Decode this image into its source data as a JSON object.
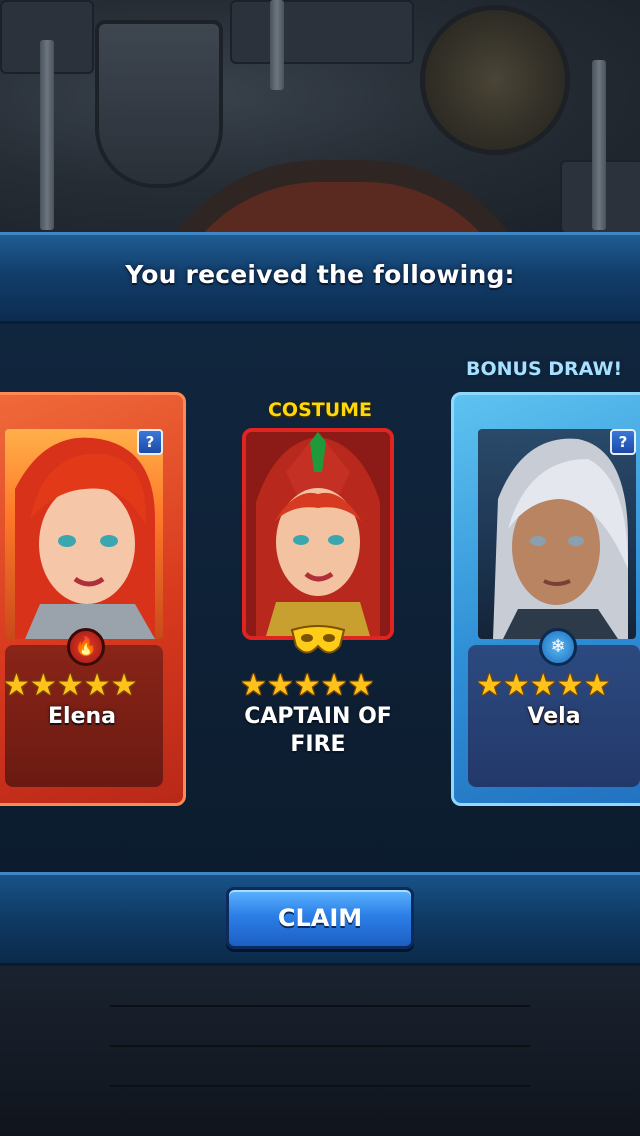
{
  "header": {
    "title": "You received the following:"
  },
  "cards": [
    {
      "name": "Elena",
      "stars": "★★★★★",
      "element": "fire",
      "element_glyph": "🔥",
      "help": "?"
    },
    {
      "top_label": "COSTUME",
      "name_line1": "CAPTAIN OF",
      "name_line2": "FIRE",
      "stars": "★★★★★",
      "help": "?"
    },
    {
      "top_label": "BONUS DRAW!",
      "name": "Vela",
      "stars": "★★★★★",
      "element": "ice",
      "element_glyph": "❄",
      "help": "?"
    }
  ],
  "footer": {
    "claim_label": "CLAIM"
  },
  "colors": {
    "fire_card": "#d83a1e",
    "ice_card": "#2f8fd6",
    "star": "#ffc21a",
    "costume_label": "#ffd80a",
    "button": "#2c7fe6"
  }
}
